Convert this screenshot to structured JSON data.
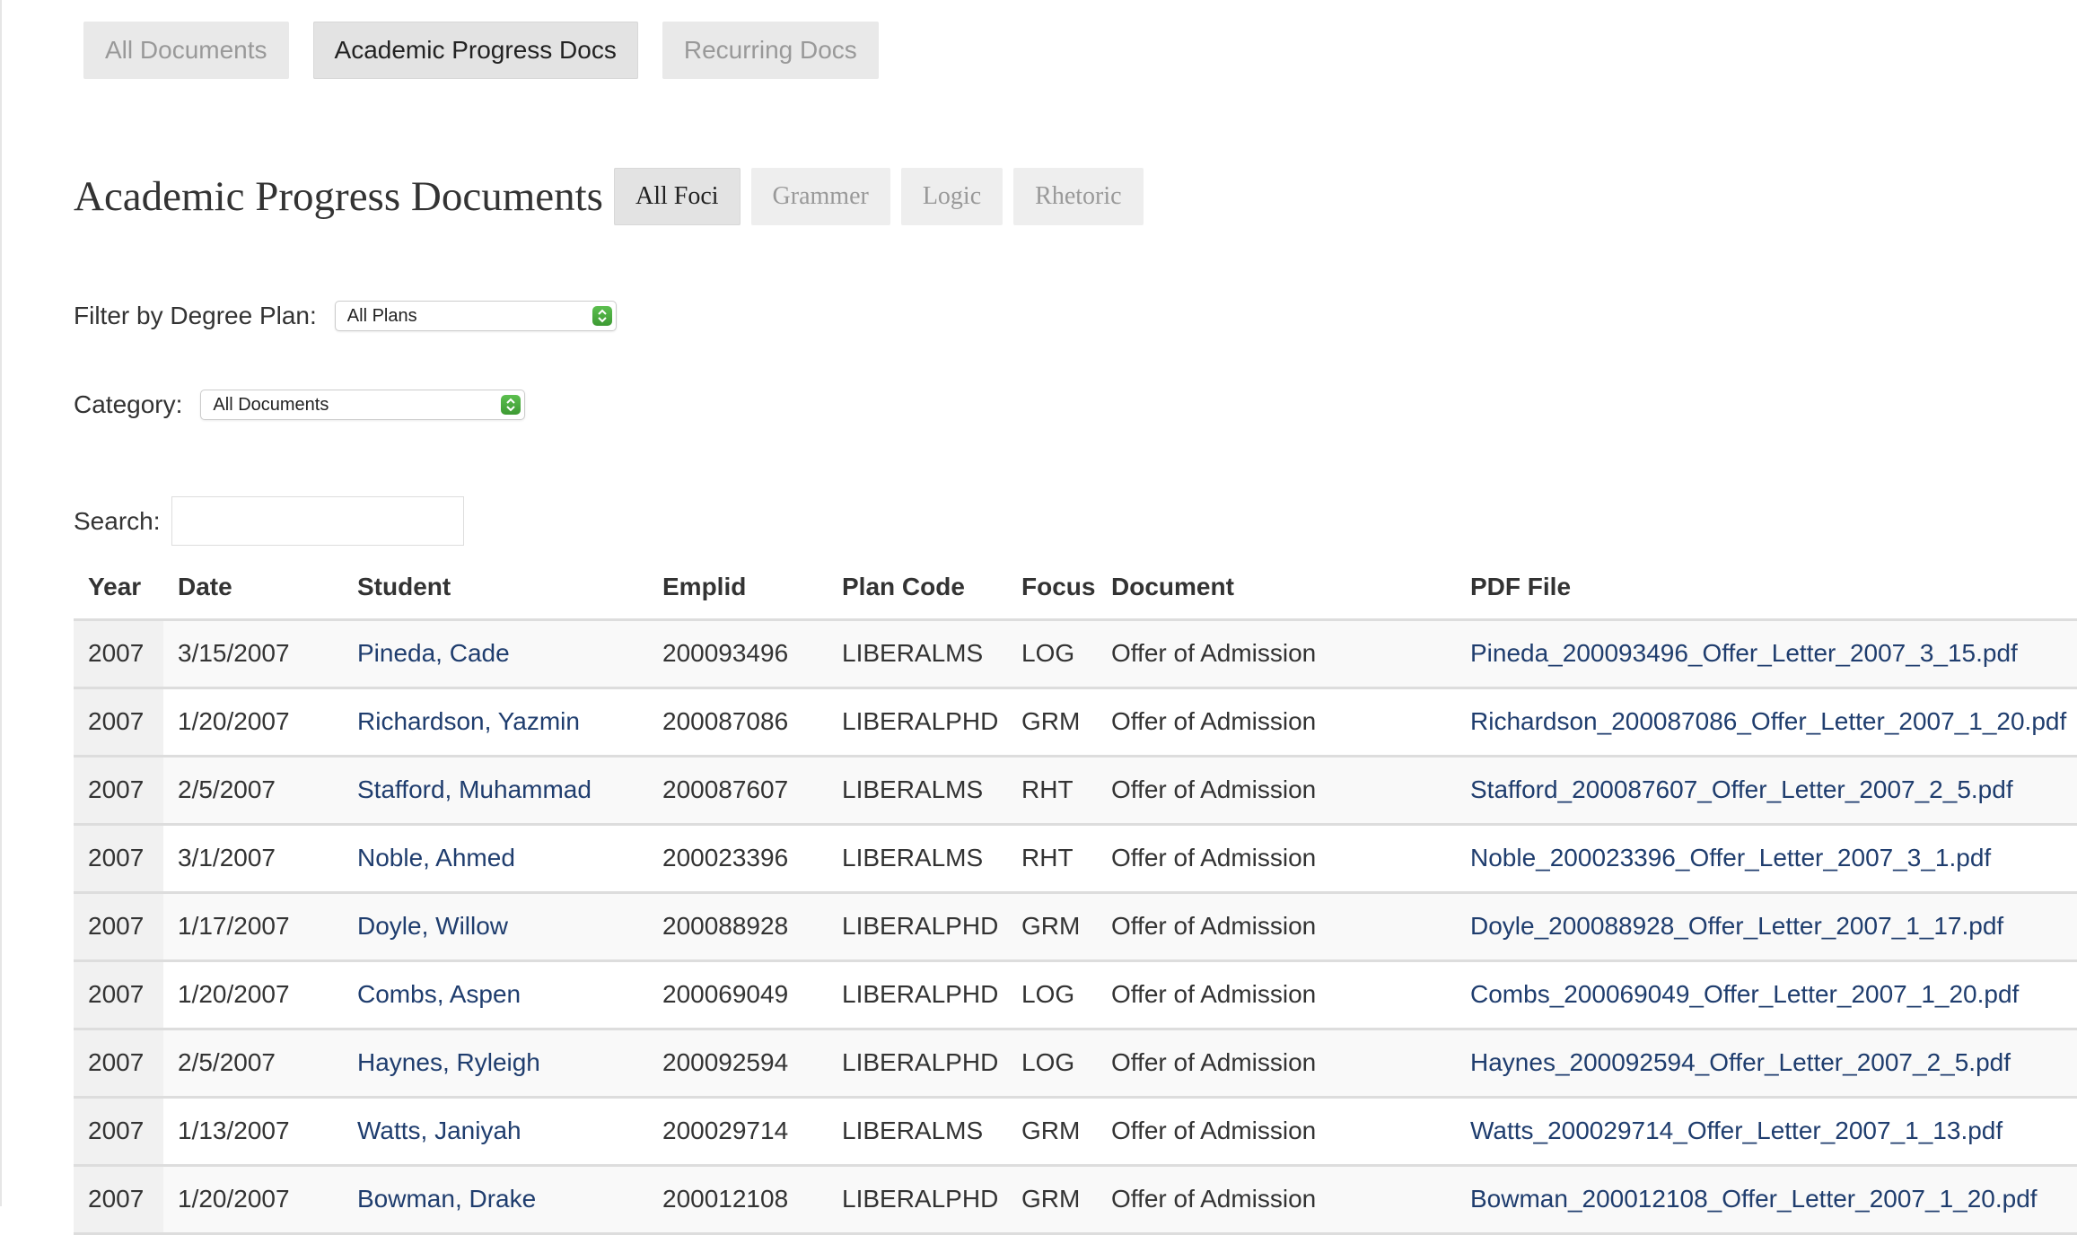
{
  "top_tabs": [
    {
      "label": "All Documents",
      "active": false
    },
    {
      "label": "Academic Progress Docs",
      "active": true
    },
    {
      "label": "Recurring Docs",
      "active": false
    }
  ],
  "page_title": "Academic Progress Documents",
  "focus_tabs": [
    {
      "label": "All Foci",
      "active": true
    },
    {
      "label": "Grammer",
      "active": false
    },
    {
      "label": "Logic",
      "active": false
    },
    {
      "label": "Rhetoric",
      "active": false
    }
  ],
  "filters": {
    "plan_label": "Filter by Degree Plan:",
    "plan_value": "All Plans",
    "category_label": "Category:",
    "category_value": "All Documents",
    "search_label": "Search:",
    "search_value": ""
  },
  "table": {
    "headers": [
      "Year",
      "Date",
      "Student",
      "Emplid",
      "Plan Code",
      "Focus",
      "Document",
      "PDF File"
    ],
    "rows": [
      {
        "year": "2007",
        "date": "3/15/2007",
        "student": "Pineda, Cade",
        "emplid": "200093496",
        "plan": "LIBERALMS",
        "focus": "LOG",
        "document": "Offer of Admission",
        "pdf": "Pineda_200093496_Offer_Letter_2007_3_15.pdf"
      },
      {
        "year": "2007",
        "date": "1/20/2007",
        "student": "Richardson, Yazmin",
        "emplid": "200087086",
        "plan": "LIBERALPHD",
        "focus": "GRM",
        "document": "Offer of Admission",
        "pdf": "Richardson_200087086_Offer_Letter_2007_1_20.pdf"
      },
      {
        "year": "2007",
        "date": "2/5/2007",
        "student": "Stafford, Muhammad",
        "emplid": "200087607",
        "plan": "LIBERALMS",
        "focus": "RHT",
        "document": "Offer of Admission",
        "pdf": "Stafford_200087607_Offer_Letter_2007_2_5.pdf"
      },
      {
        "year": "2007",
        "date": "3/1/2007",
        "student": "Noble, Ahmed",
        "emplid": "200023396",
        "plan": "LIBERALMS",
        "focus": "RHT",
        "document": "Offer of Admission",
        "pdf": "Noble_200023396_Offer_Letter_2007_3_1.pdf"
      },
      {
        "year": "2007",
        "date": "1/17/2007",
        "student": "Doyle, Willow",
        "emplid": "200088928",
        "plan": "LIBERALPHD",
        "focus": "GRM",
        "document": "Offer of Admission",
        "pdf": "Doyle_200088928_Offer_Letter_2007_1_17.pdf"
      },
      {
        "year": "2007",
        "date": "1/20/2007",
        "student": "Combs, Aspen",
        "emplid": "200069049",
        "plan": "LIBERALPHD",
        "focus": "LOG",
        "document": "Offer of Admission",
        "pdf": "Combs_200069049_Offer_Letter_2007_1_20.pdf"
      },
      {
        "year": "2007",
        "date": "2/5/2007",
        "student": "Haynes, Ryleigh",
        "emplid": "200092594",
        "plan": "LIBERALPHD",
        "focus": "LOG",
        "document": "Offer of Admission",
        "pdf": "Haynes_200092594_Offer_Letter_2007_2_5.pdf"
      },
      {
        "year": "2007",
        "date": "1/13/2007",
        "student": "Watts, Janiyah",
        "emplid": "200029714",
        "plan": "LIBERALMS",
        "focus": "GRM",
        "document": "Offer of Admission",
        "pdf": "Watts_200029714_Offer_Letter_2007_1_13.pdf"
      },
      {
        "year": "2007",
        "date": "1/20/2007",
        "student": "Bowman, Drake",
        "emplid": "200012108",
        "plan": "LIBERALPHD",
        "focus": "GRM",
        "document": "Offer of Admission",
        "pdf": "Bowman_200012108_Offer_Letter_2007_1_20.pdf"
      }
    ]
  },
  "icons": {
    "select_arrow": "up-down-chevron-icon"
  },
  "colors": {
    "link": "#1f3d6e",
    "select_arrow": "#4caf3f",
    "tab_bg": "#e9e9e9"
  }
}
